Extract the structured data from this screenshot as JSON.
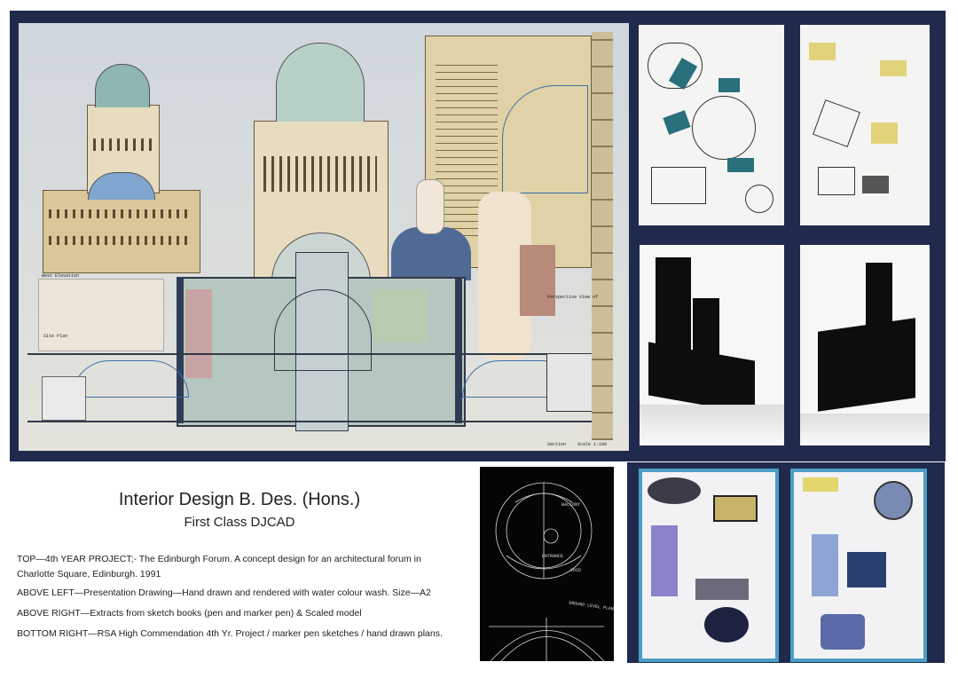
{
  "header": {
    "title": "Interior Design B. Des. (Hons.)",
    "subtitle": "First Class DJCAD"
  },
  "captions": [
    "TOP—4th YEAR PROJECT;-  The Edinburgh Forum. A concept design for an architectural forum in Charlotte Square, Edinburgh. 1991",
    "ABOVE LEFT—Presentation Drawing—Hand drawn and rendered with water colour wash. Size—A2",
    "ABOVE RIGHT—Extracts from sketch books (pen and marker pen) & Scaled model",
    "BOTTOM RIGHT—RSA High Commendation 4th Yr. Project / marker pen sketches / hand drawn plans."
  ],
  "drawing_labels": {
    "west_elevation": "West Elevation",
    "site_plan": "Site Plan",
    "perspective": "Perspective View of",
    "section": "Section",
    "scale": "Scale 1:100"
  },
  "plan_labels": {
    "balcony": "BALCONY",
    "entrance": "ENTRANCE",
    "void": "VOID",
    "ground_level_plan": "GROUND LEVEL PLAN"
  },
  "colors": {
    "panel_navy": "#1f2a4d",
    "marker_border": "#4d9ec6"
  }
}
